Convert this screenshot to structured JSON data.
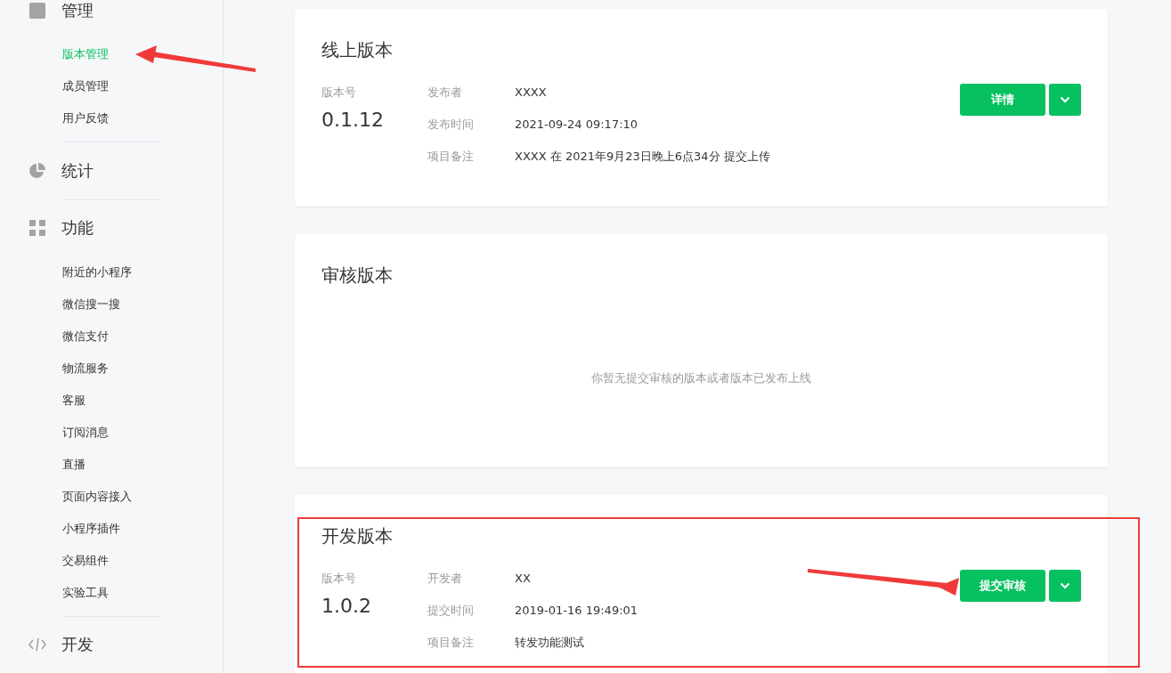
{
  "sidebar": {
    "sections": [
      {
        "title": "管理",
        "items": [
          {
            "label": "版本管理",
            "selected": true,
            "arrow": true
          },
          {
            "label": "成员管理",
            "selected": false,
            "arrow": false
          },
          {
            "label": "用户反馈",
            "selected": false,
            "arrow": false
          }
        ]
      },
      {
        "title": "统计"
      },
      {
        "title": "功能",
        "items": [
          {
            "label": "附近的小程序",
            "selected": false,
            "arrow": false
          },
          {
            "label": "微信搜一搜",
            "selected": false,
            "arrow": false
          },
          {
            "label": "微信支付",
            "selected": false,
            "arrow": false
          },
          {
            "label": "物流服务",
            "selected": false,
            "arrow": false
          },
          {
            "label": "客服",
            "selected": false,
            "arrow": false
          },
          {
            "label": "订阅消息",
            "selected": false,
            "arrow": false
          },
          {
            "label": "直播",
            "selected": false,
            "arrow": false
          },
          {
            "label": "页面内容接入",
            "selected": false,
            "arrow": false
          },
          {
            "label": "小程序插件",
            "selected": false,
            "arrow": false
          },
          {
            "label": "交易组件",
            "selected": false,
            "arrow": false
          },
          {
            "label": "实验工具",
            "selected": false,
            "arrow": false
          }
        ]
      },
      {
        "title": "开发"
      }
    ]
  },
  "cards": [
    {
      "kind": "details",
      "title": "线上版本",
      "version_label": "版本号",
      "version": "0.1.12",
      "fields": [
        {
          "label": "发布者",
          "value": "XXXX"
        },
        {
          "label": "发布时间",
          "value": "2021-09-24 09:17:10"
        },
        {
          "label": "项目备注",
          "value": "XXXX 在 2021年9月23日晚上6点34分 提交上传"
        }
      ],
      "button": "详情",
      "highlighted": false,
      "arrow": false
    },
    {
      "kind": "empty",
      "title": "审核版本",
      "message": "你暂无提交审核的版本或者版本已发布上线",
      "highlighted": false,
      "arrow": false
    },
    {
      "kind": "details",
      "title": "开发版本",
      "version_label": "版本号",
      "version": "1.0.2",
      "fields": [
        {
          "label": "开发者",
          "value": "XX"
        },
        {
          "label": "提交时间",
          "value": "2019-01-16 19:49:01"
        },
        {
          "label": "项目备注",
          "value": "转发功能测试"
        }
      ],
      "button": "提交审核",
      "highlighted": true,
      "arrow": true
    }
  ]
}
